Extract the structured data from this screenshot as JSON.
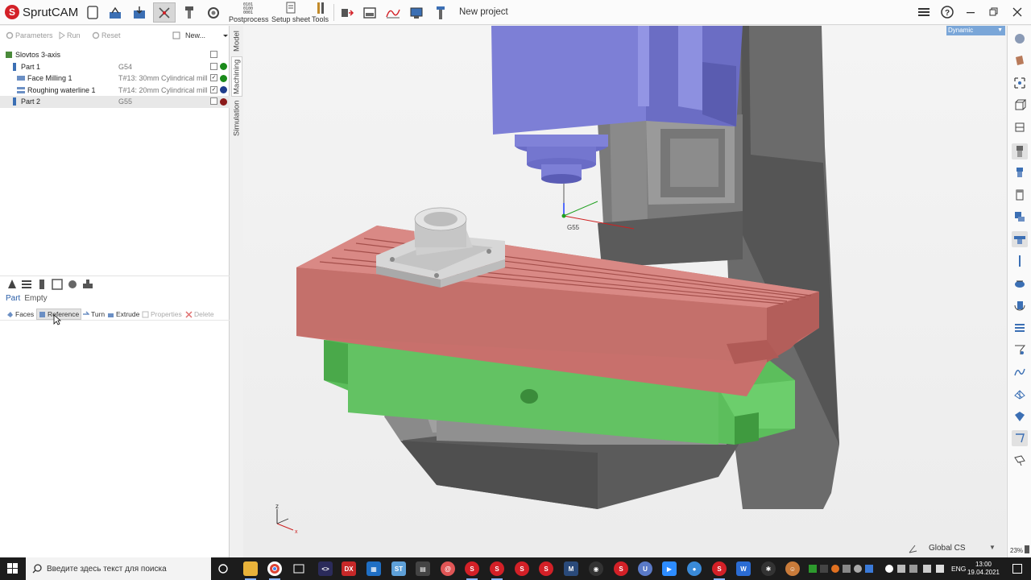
{
  "app": {
    "name": "SprutCAM",
    "project_title": "New project"
  },
  "toolbar": {
    "postprocess_label": "Postprocess",
    "setup_sheet_label": "Setup sheet",
    "tools_label": "Tools",
    "postprocess_counter": "0101\n0100\n0001"
  },
  "left_toolbar": {
    "parameters": "Parameters",
    "run": "Run",
    "reset": "Reset",
    "new": "New..."
  },
  "side_tabs": [
    "Model",
    "Machining",
    "Simulation"
  ],
  "tree": {
    "root": "Slovtos 3-axis",
    "rows": [
      {
        "name": "Part 1",
        "info": "G54",
        "dot": "#1a8a1a"
      },
      {
        "name": "Face Milling 1",
        "info": "T#13: 30mm Cylindrical mill",
        "dot": "#1a8a1a"
      },
      {
        "name": "Roughing waterline 1",
        "info": "T#14: 20mm Cylindrical mill",
        "dot": "#1f3d8c"
      },
      {
        "name": "Part 2",
        "info": "G55",
        "dot": "#8b1a1a"
      }
    ]
  },
  "properties": {
    "tabs": [
      "Part",
      "Empty"
    ],
    "actions": [
      "Faces",
      "Reference",
      "Turn",
      "Extrude",
      "Properties",
      "Delete"
    ]
  },
  "viewport": {
    "view_mode": "Dynamic",
    "coordinate_system": "Global CS",
    "workpiece_cs": "G55",
    "axis_z": "z",
    "axis_x": "x",
    "zoom": "23%",
    "colors": {
      "spindle": "#7d7fd6",
      "table": "#c8706c",
      "saddle": "#5cbe5c",
      "column": "#6a6a6a"
    }
  },
  "taskbar": {
    "search_placeholder": "Введите здесь текст для поиска",
    "language": "ENG",
    "time": "13:00",
    "date": "19.04.2021"
  }
}
